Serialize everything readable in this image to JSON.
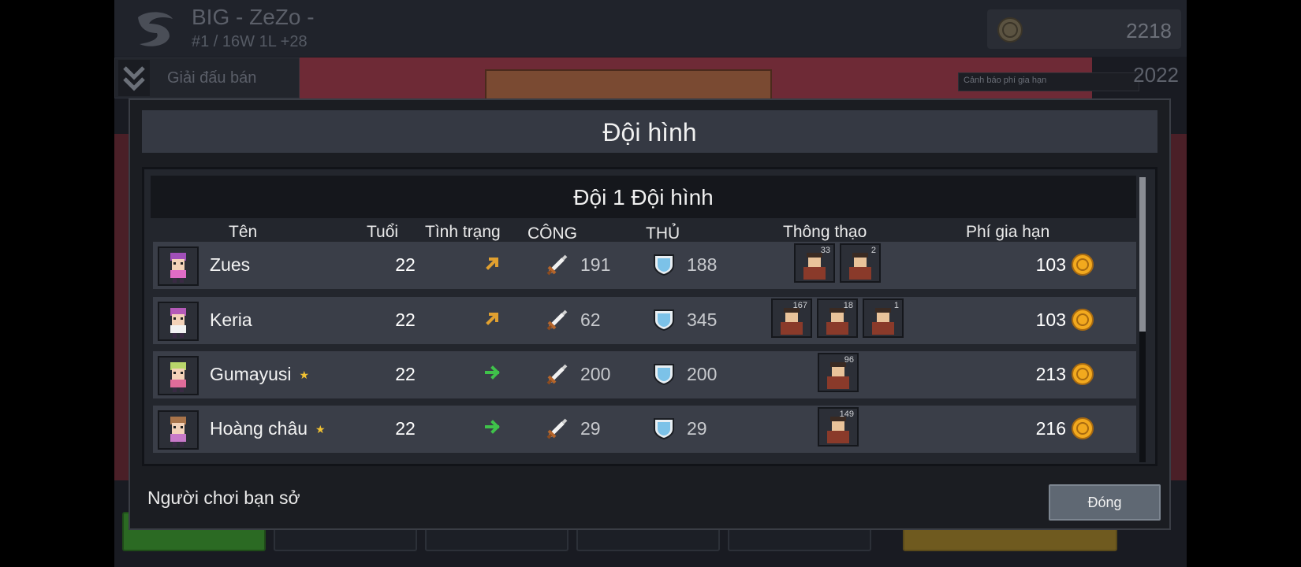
{
  "header": {
    "team_title": "BIG - ZeZo -",
    "team_record": "#1 / 16W 1L +28",
    "coins": "2218",
    "year": "2022",
    "tournament_label": "Giải đấu bán",
    "tooltip": "Cảnh báo phí gia hạn"
  },
  "modal": {
    "title": "Đội hình",
    "subtitle": "Đội 1 Đội hình",
    "columns": {
      "name": "Tên",
      "age": "Tuổi",
      "status": "Tình trạng",
      "attack": "CÔNG",
      "defense": "THỦ",
      "sponsors": "Thông thạo",
      "fee": "Phí gia hạn"
    },
    "players": [
      {
        "name": "Zues",
        "star": false,
        "age": "22",
        "status": "up",
        "attack": "191",
        "defense": "188",
        "fee": "103",
        "sponsors": [
          {
            "count": "33"
          },
          {
            "count": "2"
          }
        ]
      },
      {
        "name": "Keria",
        "star": false,
        "age": "22",
        "status": "up",
        "attack": "62",
        "defense": "345",
        "fee": "103",
        "sponsors": [
          {
            "count": "167"
          },
          {
            "count": "18"
          },
          {
            "count": "1"
          }
        ]
      },
      {
        "name": "Gumayusi",
        "star": true,
        "age": "22",
        "status": "right",
        "attack": "200",
        "defense": "200",
        "fee": "213",
        "sponsors": [
          {
            "count": "96"
          }
        ]
      },
      {
        "name": "Hoàng châu",
        "star": true,
        "age": "22",
        "status": "right",
        "attack": "29",
        "defense": "29",
        "fee": "216",
        "sponsors": [
          {
            "count": "149"
          }
        ]
      }
    ],
    "footer_text": "Người chơi bạn sở",
    "close_label": "Đóng"
  },
  "colors": {
    "accent_gold": "#f2a91e",
    "status_up": "#e0a030",
    "status_right": "#3fc24a",
    "shield": "#7cc2e8"
  }
}
